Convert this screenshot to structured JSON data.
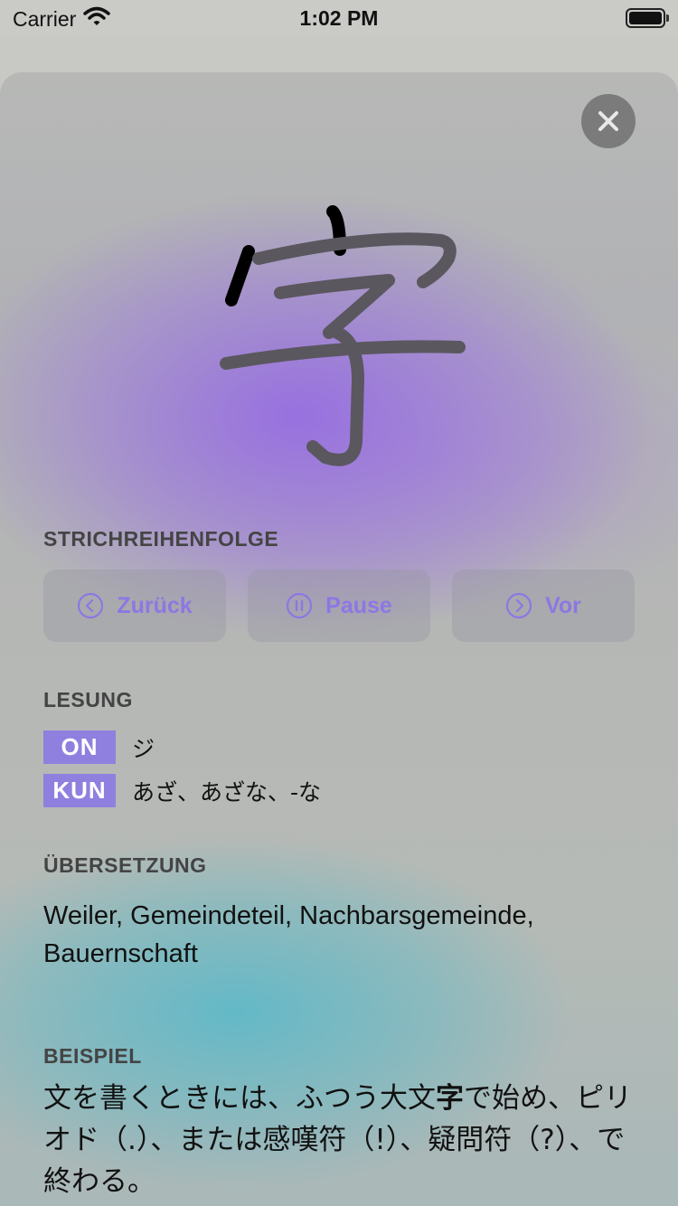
{
  "status_bar": {
    "carrier": "Carrier",
    "time": "1:02 PM"
  },
  "kanji": {
    "character": "字"
  },
  "stroke_order": {
    "title": "STRICHREIHENFOLGE",
    "back_label": "Zurück",
    "pause_label": "Pause",
    "forward_label": "Vor"
  },
  "reading": {
    "title": "LESUNG",
    "on_label": "ON",
    "on_value": "ジ",
    "kun_label": "KUN",
    "kun_value": "あざ、あざな、-な"
  },
  "translation": {
    "title": "ÜBERSETZUNG",
    "text": "Weiler, Gemeindeteil, Nachbarsgemeinde, Bauernschaft"
  },
  "example": {
    "title": "BEISPIEL",
    "text_before": "文を書くときには、ふつう大文",
    "highlight": "字",
    "text_after": "で始め、ピリオド（.）、または感嘆符（!）、疑問符（?）、で終わる。"
  },
  "colors": {
    "accent": "#8d77e3",
    "badge": "#8f80df",
    "close_button": "#7b7b7b"
  }
}
